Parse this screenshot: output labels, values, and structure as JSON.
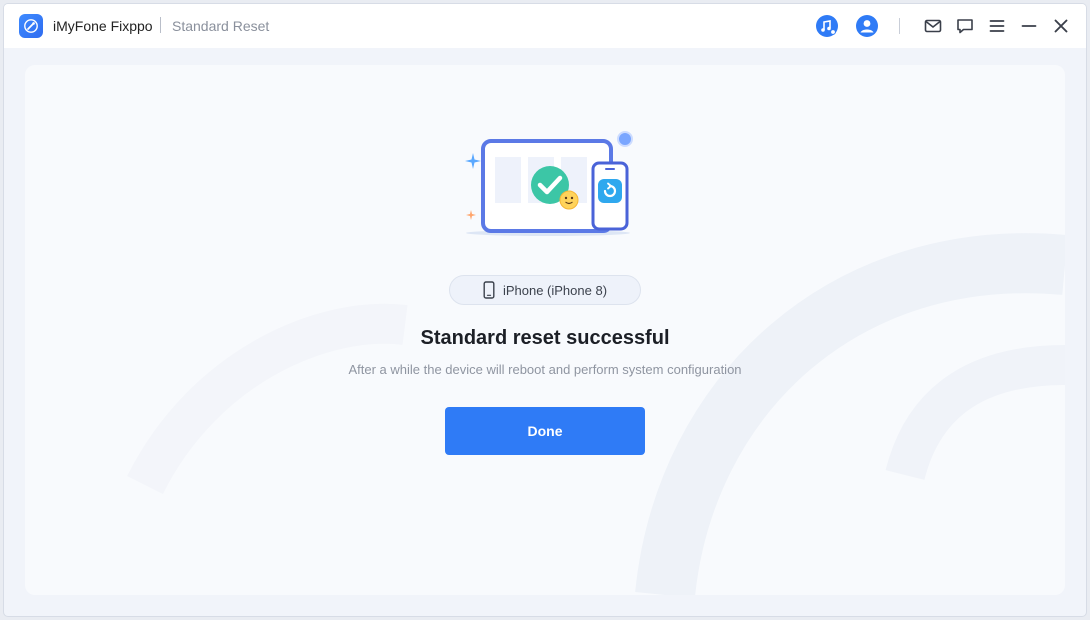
{
  "titlebar": {
    "app_name": "iMyFone Fixppo",
    "page_name": "Standard Reset",
    "icons": [
      "wrench-logo-icon",
      "music-search-icon",
      "user-icon",
      "mail-icon",
      "chat-icon",
      "menu-icon",
      "minimize-icon",
      "close-icon"
    ]
  },
  "device": {
    "label": "iPhone (iPhone 8)",
    "icon": "phone-icon"
  },
  "result": {
    "headline": "Standard reset successful",
    "description": "After a while the device will reboot and perform system configuration"
  },
  "actions": {
    "done_label": "Done"
  },
  "colors": {
    "accent": "#2f7bf6",
    "window_bg": "#f1f4fa",
    "card_bg": "#f8fafd",
    "success_green": "#3cc6a6"
  }
}
